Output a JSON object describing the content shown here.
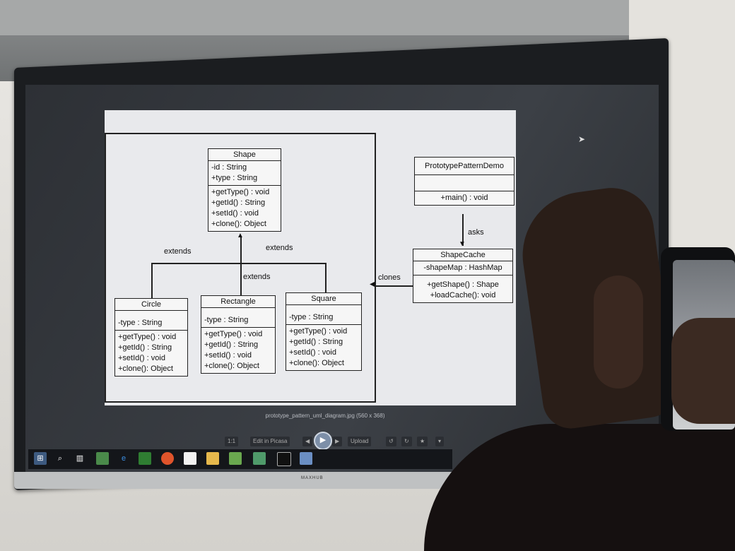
{
  "diagram": {
    "shape": {
      "name": "Shape",
      "attrs": [
        "-id : String",
        "+type : String"
      ],
      "methods": [
        "+getType() : void",
        "+getId() : String",
        "+setId() : void",
        "+clone(): Object"
      ]
    },
    "circle": {
      "name": "Circle",
      "attrs": [
        "-type : String"
      ],
      "methods": [
        "+getType() : void",
        "+getId() : String",
        "+setId() : void",
        "+clone(): Object"
      ]
    },
    "rectangle": {
      "name": "Rectangle",
      "attrs": [
        "-type : String"
      ],
      "methods": [
        "+getType() : void",
        "+getId() : String",
        "+setId() : void",
        "+clone(): Object"
      ]
    },
    "square": {
      "name": "Square",
      "attrs": [
        "-type : String"
      ],
      "methods": [
        "+getType() : void",
        "+getId() : String",
        "+setId() : void",
        "+clone(): Object"
      ]
    },
    "demo": {
      "name": "PrototypePatternDemo",
      "methods": [
        "+main() : void"
      ]
    },
    "cache": {
      "name": "ShapeCache",
      "attrs": [
        "-shapeMap : HashMap"
      ],
      "methods": [
        "+getShape() : Shape",
        "+loadCache(): void"
      ]
    },
    "labels": {
      "extends_left": "extends",
      "extends_right": "extends",
      "extends_mid": "extends",
      "asks": "asks",
      "clones": "clones"
    }
  },
  "viewer": {
    "caption": "prototype_pattern_uml_diagram.jpg (560 x 368)",
    "ratio": "1:1",
    "edit": "Edit in Picasa",
    "upload": "Upload"
  },
  "tv": {
    "brand": "MAXHUB"
  }
}
